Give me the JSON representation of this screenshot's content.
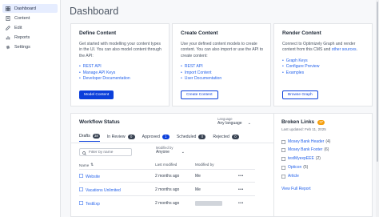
{
  "sidebar": {
    "items": [
      {
        "label": "Dashboard",
        "icon": "dashboard-icon"
      },
      {
        "label": "Content",
        "icon": "content-icon"
      },
      {
        "label": "Edit",
        "icon": "edit-icon"
      },
      {
        "label": "Reports",
        "icon": "reports-icon"
      },
      {
        "label": "Settings",
        "icon": "gear-icon"
      }
    ]
  },
  "page": {
    "title": "Dashboard"
  },
  "cards": {
    "define": {
      "title": "Define Content",
      "description": "Get started with modelling your content types in the UI. You can also model content through the API:",
      "links": [
        "REST API",
        "Manage API Keys",
        "Developer Documentation"
      ],
      "button": "Model Content"
    },
    "create": {
      "title": "Create Content",
      "description": "Use your defined content models to create content. You can also import or use the API to create content:",
      "links": [
        "REST API",
        "Import Content",
        "User Documentation"
      ],
      "button": "Create Content"
    },
    "render": {
      "title": "Render Content",
      "description_start": "Connect to Optimizely Graph and render content from this CMS and ",
      "description_link": "other sources",
      "description_end": ".",
      "links": [
        "Graph Keys",
        "Configure Preview",
        "Examples"
      ],
      "button": "Browse Graph"
    }
  },
  "workflow": {
    "title": "Workflow Status",
    "language_label": "Language",
    "language_value": "Any language",
    "tabs": [
      {
        "label": "Drafts",
        "count": "38",
        "active": true
      },
      {
        "label": "In Review",
        "count": "0"
      },
      {
        "label": "Approved",
        "count": "1"
      },
      {
        "label": "Scheduled",
        "count": "0"
      },
      {
        "label": "Rejected",
        "count": "0"
      }
    ],
    "search_placeholder": "Filter by name",
    "modified_by_label": "Modified by",
    "modified_by_value": "Anyone",
    "columns": {
      "name": "Name",
      "last_modified": "Last modified",
      "modified_by": "Modified by"
    },
    "rows": [
      {
        "name": "Website",
        "last_modified": "2 months ago",
        "modified_by": "Me",
        "more": "•••"
      },
      {
        "name": "Vacations Unlimited",
        "last_modified": "2 months ago",
        "modified_by": "Me",
        "more": "•••"
      },
      {
        "name": "TestExp",
        "last_modified": "2 months ago",
        "modified_by": "",
        "more": "•••"
      }
    ]
  },
  "broken_links": {
    "title": "Broken Links",
    "badge": "37",
    "last_updated": "Last updated: Feb 11, 2025",
    "items": [
      {
        "name": "Mosey Bank Header",
        "count": "(4)"
      },
      {
        "name": "Mosey Bank Footer",
        "count": "(6)"
      },
      {
        "name": "testMyexpEEE",
        "count": "(2)"
      },
      {
        "name": "Opticon",
        "count": "(5)"
      },
      {
        "name": "Article",
        "count": ""
      }
    ],
    "view_full": "View Full Report"
  },
  "colors": {
    "primary": "#0b3fdb",
    "link": "#2563eb",
    "warning_badge": "#f59e0b"
  }
}
